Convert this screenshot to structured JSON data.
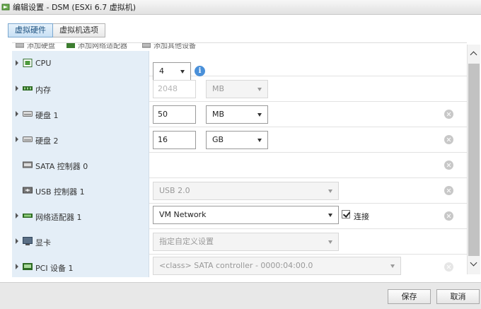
{
  "window": {
    "title": "编辑设置 - DSM (ESXi 6.7 虚拟机)"
  },
  "tabs": [
    {
      "label": "虚拟硬件",
      "active": true
    },
    {
      "label": "虚拟机选项",
      "active": false
    }
  ],
  "add_toolbar": {
    "add_disk": "添加硬盘",
    "add_network": "添加网络适配器",
    "add_other": "添加其他设备"
  },
  "devices": {
    "cpu": {
      "label": "CPU",
      "value": "4",
      "icon": "cpu-icon"
    },
    "memory": {
      "label": "内存",
      "value": "2048",
      "unit": "MB",
      "icon": "memory-icon"
    },
    "disk1": {
      "label": "硬盘 1",
      "size": "50",
      "unit": "MB",
      "icon": "disk-icon"
    },
    "disk2": {
      "label": "硬盘 2",
      "size": "16",
      "unit": "GB",
      "icon": "disk-icon"
    },
    "sata": {
      "label": "SATA 控制器 0",
      "icon": "sata-icon"
    },
    "usb": {
      "label": "USB 控制器 1",
      "value": "USB 2.0",
      "icon": "usb-icon"
    },
    "network": {
      "label": "网络适配器 1",
      "value": "VM Network",
      "connect_label": "连接",
      "connected": true,
      "icon": "network-icon"
    },
    "display": {
      "label": "显卡",
      "value": "指定自定义设置",
      "icon": "monitor-icon"
    },
    "pci": {
      "label": "PCI 设备 1",
      "value": "<class> SATA controller - 0000:04:00.0",
      "icon": "pci-icon"
    }
  },
  "footer": {
    "save": "保存",
    "cancel": "取消"
  },
  "colors": {
    "label_bg": "#e4eef7",
    "info_icon": "#4a90d9",
    "active_tab": "#c8e0f4"
  }
}
